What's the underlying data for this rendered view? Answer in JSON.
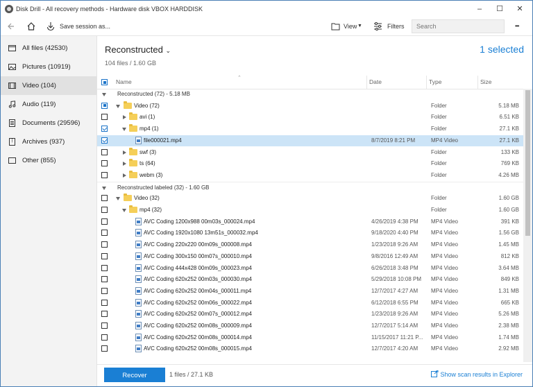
{
  "window": {
    "title": "Disk Drill - All recovery methods - Hardware disk VBOX HARDDISK"
  },
  "toolbar": {
    "save_label": "Save session as...",
    "view_label": "View",
    "filters_label": "Filters",
    "search_placeholder": "Search",
    "more_label": "•••"
  },
  "sidebar": {
    "items": [
      {
        "label": "All files (42530)"
      },
      {
        "label": "Pictures (10919)"
      },
      {
        "label": "Video (104)"
      },
      {
        "label": "Audio (119)"
      },
      {
        "label": "Documents (29596)"
      },
      {
        "label": "Archives (937)"
      },
      {
        "label": "Other (855)"
      }
    ]
  },
  "main": {
    "title": "Reconstructed",
    "subtitle": "104 files / 1.60 GB",
    "selected": "1 selected",
    "columns": {
      "name": "Name",
      "date": "Date",
      "type": "Type",
      "size": "Size"
    },
    "groups": [
      {
        "label": "Reconstructed (72) - 5.18 MB"
      },
      {
        "label": "Reconstructed labeled (32) - 1.60 GB"
      }
    ],
    "rows": [
      {
        "name": "Video (72)",
        "date": "",
        "type": "Folder",
        "size": "5.18 MB"
      },
      {
        "name": "avi (1)",
        "date": "",
        "type": "Folder",
        "size": "6.51 KB"
      },
      {
        "name": "mp4 (1)",
        "date": "",
        "type": "Folder",
        "size": "27.1 KB"
      },
      {
        "name": "file000021.mp4",
        "date": "8/7/2019 8:21 PM",
        "type": "MP4 Video",
        "size": "27.1 KB"
      },
      {
        "name": "swf (3)",
        "date": "",
        "type": "Folder",
        "size": "133 KB"
      },
      {
        "name": "ts (64)",
        "date": "",
        "type": "Folder",
        "size": "769 KB"
      },
      {
        "name": "webm (3)",
        "date": "",
        "type": "Folder",
        "size": "4.26 MB"
      },
      {
        "name": "Video (32)",
        "date": "",
        "type": "Folder",
        "size": "1.60 GB"
      },
      {
        "name": "mp4 (32)",
        "date": "",
        "type": "Folder",
        "size": "1.60 GB"
      },
      {
        "name": "AVC Coding 1200x988 00m03s_000024.mp4",
        "date": "4/26/2019 4:38 PM",
        "type": "MP4 Video",
        "size": "391 KB"
      },
      {
        "name": "AVC Coding 1920x1080 13m51s_000032.mp4",
        "date": "9/18/2020 4:40 PM",
        "type": "MP4 Video",
        "size": "1.56 GB"
      },
      {
        "name": "AVC Coding 220x220 00m09s_000008.mp4",
        "date": "1/23/2018 9:26 AM",
        "type": "MP4 Video",
        "size": "1.45 MB"
      },
      {
        "name": "AVC Coding 300x150 00m07s_000010.mp4",
        "date": "9/8/2016 12:49 AM",
        "type": "MP4 Video",
        "size": "812 KB"
      },
      {
        "name": "AVC Coding 444x428 00m09s_000023.mp4",
        "date": "6/26/2018 3:48 PM",
        "type": "MP4 Video",
        "size": "3.64 MB"
      },
      {
        "name": "AVC Coding 620x252 00m03s_000030.mp4",
        "date": "5/29/2018 10:08 PM",
        "type": "MP4 Video",
        "size": "849 KB"
      },
      {
        "name": "AVC Coding 620x252 00m04s_000011.mp4",
        "date": "12/7/2017 4:27 AM",
        "type": "MP4 Video",
        "size": "1.31 MB"
      },
      {
        "name": "AVC Coding 620x252 00m06s_000022.mp4",
        "date": "6/12/2018 6:55 PM",
        "type": "MP4 Video",
        "size": "665 KB"
      },
      {
        "name": "AVC Coding 620x252 00m07s_000012.mp4",
        "date": "1/23/2018 9:26 AM",
        "type": "MP4 Video",
        "size": "5.26 MB"
      },
      {
        "name": "AVC Coding 620x252 00m08s_000009.mp4",
        "date": "12/7/2017 5:14 AM",
        "type": "MP4 Video",
        "size": "2.38 MB"
      },
      {
        "name": "AVC Coding 620x252 00m08s_000014.mp4",
        "date": "11/15/2017 11:21 P...",
        "type": "MP4 Video",
        "size": "1.74 MB"
      },
      {
        "name": "AVC Coding 620x252 00m08s_000015.mp4",
        "date": "12/7/2017 4:20 AM",
        "type": "MP4 Video",
        "size": "2.92 MB"
      }
    ]
  },
  "footer": {
    "recover_label": "Recover",
    "info": "1 files / 27.1 KB",
    "link": "Show scan results in Explorer"
  },
  "colors": {
    "accent": "#1a7fd4",
    "selection": "#cce4f7",
    "folder": "#f5cf59"
  }
}
